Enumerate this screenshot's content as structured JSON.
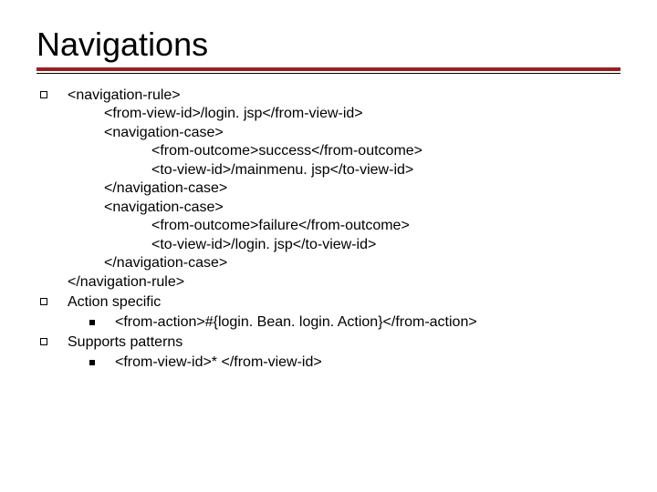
{
  "title": "Navigations",
  "b1": {
    "l1": "<navigation-rule>",
    "l2": "<from-view-id>/login. jsp</from-view-id>",
    "l3": "<navigation-case>",
    "l4": "<from-outcome>success</from-outcome>",
    "l5": "<to-view-id>/mainmenu. jsp</to-view-id>",
    "l6": "</navigation-case>",
    "l7": "<navigation-case>",
    "l8": "<from-outcome>failure</from-outcome>",
    "l9": "<to-view-id>/login. jsp</to-view-id>",
    "l10": "</navigation-case>",
    "l11": "</navigation-rule>"
  },
  "b2": {
    "head": "Action specific",
    "sub1": "<from-action>#{login. Bean. login. Action}</from-action>"
  },
  "b3": {
    "head": "Supports patterns",
    "sub1": "<from-view-id>* </from-view-id>"
  }
}
